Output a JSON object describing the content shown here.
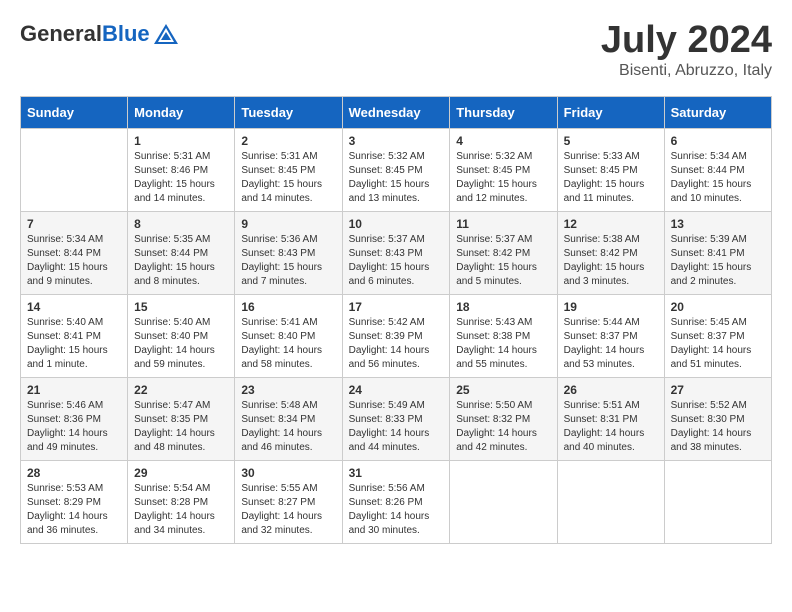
{
  "logo": {
    "general": "General",
    "blue": "Blue"
  },
  "title": "July 2024",
  "location": "Bisenti, Abruzzo, Italy",
  "days_of_week": [
    "Sunday",
    "Monday",
    "Tuesday",
    "Wednesday",
    "Thursday",
    "Friday",
    "Saturday"
  ],
  "weeks": [
    [
      {
        "day": "",
        "info": ""
      },
      {
        "day": "1",
        "info": "Sunrise: 5:31 AM\nSunset: 8:46 PM\nDaylight: 15 hours\nand 14 minutes."
      },
      {
        "day": "2",
        "info": "Sunrise: 5:31 AM\nSunset: 8:45 PM\nDaylight: 15 hours\nand 14 minutes."
      },
      {
        "day": "3",
        "info": "Sunrise: 5:32 AM\nSunset: 8:45 PM\nDaylight: 15 hours\nand 13 minutes."
      },
      {
        "day": "4",
        "info": "Sunrise: 5:32 AM\nSunset: 8:45 PM\nDaylight: 15 hours\nand 12 minutes."
      },
      {
        "day": "5",
        "info": "Sunrise: 5:33 AM\nSunset: 8:45 PM\nDaylight: 15 hours\nand 11 minutes."
      },
      {
        "day": "6",
        "info": "Sunrise: 5:34 AM\nSunset: 8:44 PM\nDaylight: 15 hours\nand 10 minutes."
      }
    ],
    [
      {
        "day": "7",
        "info": "Sunrise: 5:34 AM\nSunset: 8:44 PM\nDaylight: 15 hours\nand 9 minutes."
      },
      {
        "day": "8",
        "info": "Sunrise: 5:35 AM\nSunset: 8:44 PM\nDaylight: 15 hours\nand 8 minutes."
      },
      {
        "day": "9",
        "info": "Sunrise: 5:36 AM\nSunset: 8:43 PM\nDaylight: 15 hours\nand 7 minutes."
      },
      {
        "day": "10",
        "info": "Sunrise: 5:37 AM\nSunset: 8:43 PM\nDaylight: 15 hours\nand 6 minutes."
      },
      {
        "day": "11",
        "info": "Sunrise: 5:37 AM\nSunset: 8:42 PM\nDaylight: 15 hours\nand 5 minutes."
      },
      {
        "day": "12",
        "info": "Sunrise: 5:38 AM\nSunset: 8:42 PM\nDaylight: 15 hours\nand 3 minutes."
      },
      {
        "day": "13",
        "info": "Sunrise: 5:39 AM\nSunset: 8:41 PM\nDaylight: 15 hours\nand 2 minutes."
      }
    ],
    [
      {
        "day": "14",
        "info": "Sunrise: 5:40 AM\nSunset: 8:41 PM\nDaylight: 15 hours\nand 1 minute."
      },
      {
        "day": "15",
        "info": "Sunrise: 5:40 AM\nSunset: 8:40 PM\nDaylight: 14 hours\nand 59 minutes."
      },
      {
        "day": "16",
        "info": "Sunrise: 5:41 AM\nSunset: 8:40 PM\nDaylight: 14 hours\nand 58 minutes."
      },
      {
        "day": "17",
        "info": "Sunrise: 5:42 AM\nSunset: 8:39 PM\nDaylight: 14 hours\nand 56 minutes."
      },
      {
        "day": "18",
        "info": "Sunrise: 5:43 AM\nSunset: 8:38 PM\nDaylight: 14 hours\nand 55 minutes."
      },
      {
        "day": "19",
        "info": "Sunrise: 5:44 AM\nSunset: 8:37 PM\nDaylight: 14 hours\nand 53 minutes."
      },
      {
        "day": "20",
        "info": "Sunrise: 5:45 AM\nSunset: 8:37 PM\nDaylight: 14 hours\nand 51 minutes."
      }
    ],
    [
      {
        "day": "21",
        "info": "Sunrise: 5:46 AM\nSunset: 8:36 PM\nDaylight: 14 hours\nand 49 minutes."
      },
      {
        "day": "22",
        "info": "Sunrise: 5:47 AM\nSunset: 8:35 PM\nDaylight: 14 hours\nand 48 minutes."
      },
      {
        "day": "23",
        "info": "Sunrise: 5:48 AM\nSunset: 8:34 PM\nDaylight: 14 hours\nand 46 minutes."
      },
      {
        "day": "24",
        "info": "Sunrise: 5:49 AM\nSunset: 8:33 PM\nDaylight: 14 hours\nand 44 minutes."
      },
      {
        "day": "25",
        "info": "Sunrise: 5:50 AM\nSunset: 8:32 PM\nDaylight: 14 hours\nand 42 minutes."
      },
      {
        "day": "26",
        "info": "Sunrise: 5:51 AM\nSunset: 8:31 PM\nDaylight: 14 hours\nand 40 minutes."
      },
      {
        "day": "27",
        "info": "Sunrise: 5:52 AM\nSunset: 8:30 PM\nDaylight: 14 hours\nand 38 minutes."
      }
    ],
    [
      {
        "day": "28",
        "info": "Sunrise: 5:53 AM\nSunset: 8:29 PM\nDaylight: 14 hours\nand 36 minutes."
      },
      {
        "day": "29",
        "info": "Sunrise: 5:54 AM\nSunset: 8:28 PM\nDaylight: 14 hours\nand 34 minutes."
      },
      {
        "day": "30",
        "info": "Sunrise: 5:55 AM\nSunset: 8:27 PM\nDaylight: 14 hours\nand 32 minutes."
      },
      {
        "day": "31",
        "info": "Sunrise: 5:56 AM\nSunset: 8:26 PM\nDaylight: 14 hours\nand 30 minutes."
      },
      {
        "day": "",
        "info": ""
      },
      {
        "day": "",
        "info": ""
      },
      {
        "day": "",
        "info": ""
      }
    ]
  ]
}
